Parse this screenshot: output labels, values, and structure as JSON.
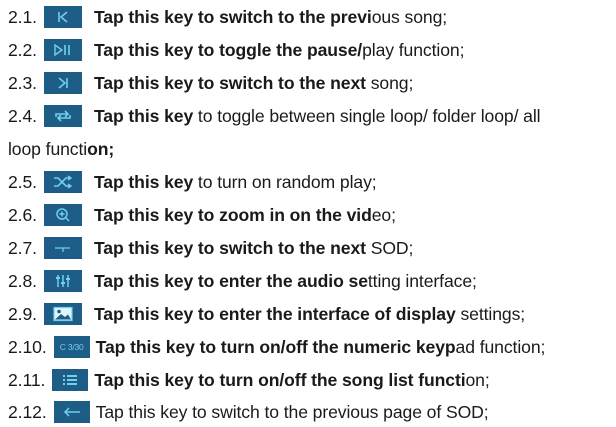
{
  "items": [
    {
      "num": "2.1.",
      "icon": "previous-track-icon",
      "bold": "Tap this key to switch to the previ",
      "rest": "ous song;"
    },
    {
      "num": "2.2.",
      "icon": "play-pause-icon",
      "bold": "Tap this key to toggle the pause/",
      "rest": "play function;"
    },
    {
      "num": "2.3.",
      "icon": "next-track-icon",
      "bold": "Tap this key to switch to the next",
      "rest": " song;"
    },
    {
      "num": "2.4.",
      "icon": "loop-icon",
      "bold": "Tap this key",
      "rest": " to toggle between single loop/ folder loop/ all"
    },
    {
      "cont": "loop functi",
      "cont_b": "on;"
    },
    {
      "num": "2.5.",
      "icon": "shuffle-icon",
      "bold": "Tap this key",
      "rest": " to turn on random play;"
    },
    {
      "num": "2.6.",
      "icon": "zoom-in-icon",
      "bold": "Tap this key to zoom in on the vid",
      "rest": "eo;"
    },
    {
      "num": "2.7.",
      "icon": "next-sod-icon",
      "bold": "Tap this key to switch to the next",
      "rest": " SOD;"
    },
    {
      "num": "2.8.",
      "icon": "audio-settings-icon",
      "bold": "Tap this key to enter the audio se",
      "rest": "tting interface;"
    },
    {
      "num": "2.9.",
      "icon": "display-settings-icon",
      "bold": "Tap this key to enter the interface of display",
      "rest": " settings;"
    },
    {
      "num": "2.10.",
      "icon": "numeric-keypad-icon",
      "icon_text": "C 3/30",
      "bold": "Tap this key to turn on/off the numeric keyp",
      "rest": "ad function;"
    },
    {
      "num": "2.11.",
      "icon": "song-list-icon",
      "bold": "Tap this key to turn on/off the song list functi",
      "rest": "on;"
    },
    {
      "num": "2.12.",
      "icon": "previous-page-icon",
      "bold": "",
      "rest": "Tap this key to switch to the previous page of SOD;"
    }
  ],
  "colors": {
    "icon_bg": "#1d5d86",
    "icon_fg": "#6fd0f0"
  }
}
